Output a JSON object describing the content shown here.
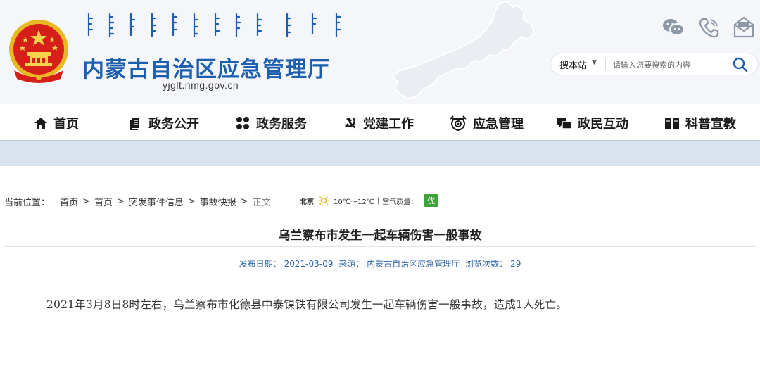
{
  "header": {
    "site_title": "内蒙古自治区应急管理厅",
    "site_domain": "yjglt.nmg.gov.cn"
  },
  "top_icons": [
    "wechat-icon",
    "phone-icon",
    "mail-icon"
  ],
  "search": {
    "scope_label": "搜本站",
    "placeholder": "请输入您要搜索的内容"
  },
  "nav": {
    "items": [
      {
        "label": "首页",
        "icon": "home-icon"
      },
      {
        "label": "政务公开",
        "icon": "document-icon"
      },
      {
        "label": "政务服务",
        "icon": "services-icon"
      },
      {
        "label": "党建工作",
        "icon": "party-icon"
      },
      {
        "label": "应急管理",
        "icon": "emergency-icon"
      },
      {
        "label": "政民互动",
        "icon": "interaction-icon"
      },
      {
        "label": "科普宣教",
        "icon": "book-icon"
      }
    ]
  },
  "breadcrumb": {
    "prefix": "当前位置：",
    "items": [
      "首页",
      "首页",
      "突发事件信息",
      "事故快报"
    ],
    "current": "正文",
    "separator": ">"
  },
  "weather": {
    "city": "北京",
    "icon": "sun-icon",
    "temperature": "10℃～12℃",
    "aq_label": "空气质量：",
    "aq_value": "优",
    "aq_color": "#3fa23a"
  },
  "article": {
    "title": "乌兰察布市发生一起车辆伤害一般事故",
    "date_label": "发布日期：",
    "date": "2021-03-09",
    "source_label": "来源：",
    "source": "内蒙古自治区应急管理厅",
    "views_label": "浏览次数：",
    "views": "29",
    "body": "2021年3月8日8时左右，乌兰察布市化德县中泰镍铁有限公司发生一起车辆伤害一般事故，造成1人死亡。"
  },
  "colors": {
    "title_blue": "#1c5fb0",
    "meta_blue": "#2f67a7",
    "header_bg": "#f4f6f9",
    "band_bg": "#dae4ee"
  }
}
